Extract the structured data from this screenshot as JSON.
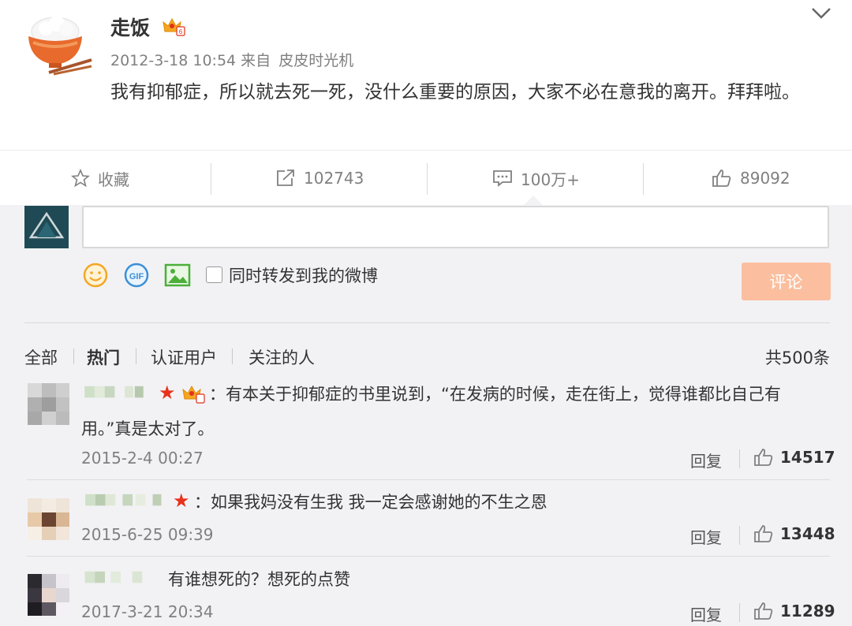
{
  "post": {
    "author": "走饭",
    "time": "2012-3-18 10:54",
    "source_prefix": "来自",
    "source": "皮皮时光机",
    "text": "我有抑郁症，所以就去死一死，没什么重要的原因，大家不必在意我的离开。拜拜啦。"
  },
  "actions": {
    "favorite": "收藏",
    "repost": "102743",
    "comment": "100万+",
    "like": "89092"
  },
  "composer": {
    "repost_label": "同时转发到我的微博",
    "submit": "评论",
    "gif_label": "GIF"
  },
  "filters": {
    "tabs": [
      "全部",
      "热门",
      "认证用户",
      "关注的人"
    ],
    "active": "热门",
    "total": "共500条"
  },
  "comments": [
    {
      "text": "：有本关于抑郁症的书里说到，“在发病的时候，走在街上，觉得谁都比自己有用。”真是太对了。",
      "time": "2015-2-4 00:27",
      "reply": "回复",
      "likes": "14517"
    },
    {
      "text": "：如果我妈没有生我 我一定会感谢她的不生之恩",
      "time": "2015-6-25 09:39",
      "reply": "回复",
      "likes": "13448"
    },
    {
      "text": "有谁想死的？想死的点赞",
      "time": "2017-3-21 20:34",
      "reply": "回复",
      "likes": "11289"
    }
  ],
  "colors": {
    "accent_orange": "#fbbf9f",
    "star_red": "#e8321c",
    "muted_text": "#808080"
  },
  "icons": [
    "bowl-avatar-icon",
    "vip-crown-icon",
    "chevron-down-icon",
    "star-outline-icon",
    "repost-icon",
    "comment-icon",
    "thumb-up-icon",
    "smiley-icon",
    "gif-icon",
    "image-icon"
  ]
}
